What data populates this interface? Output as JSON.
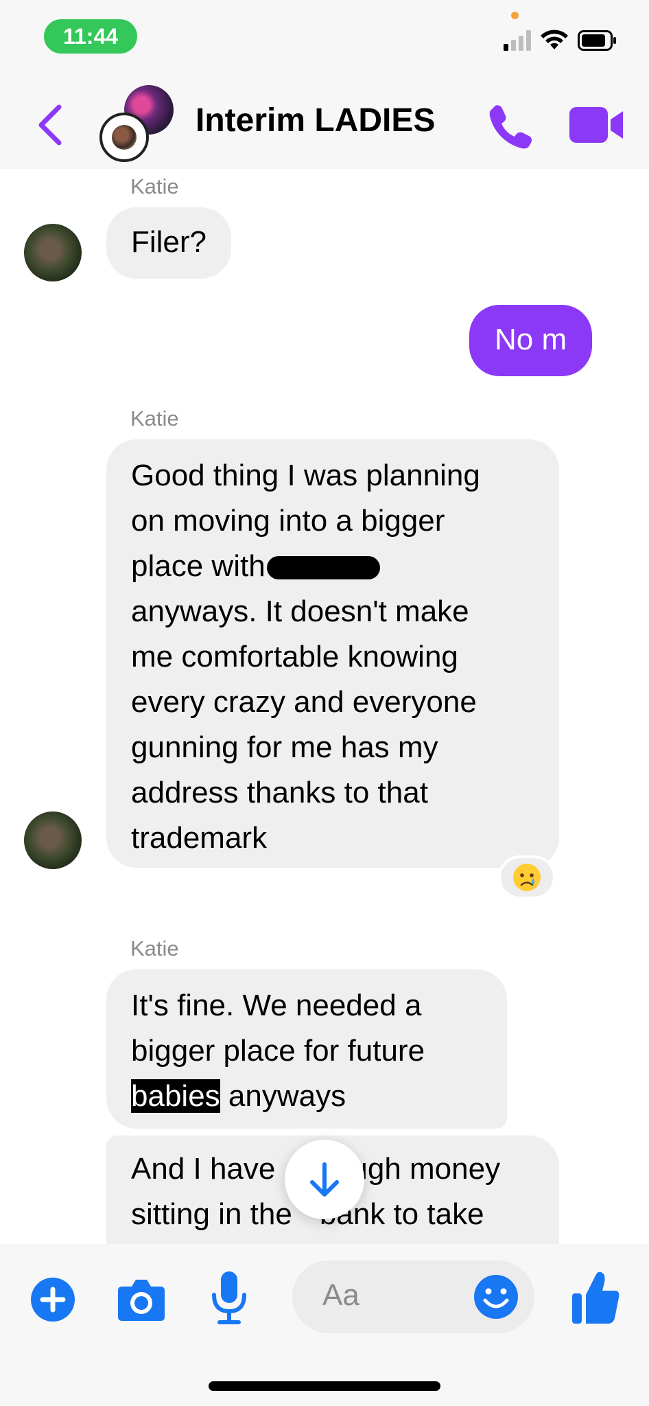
{
  "status_bar": {
    "time": "11:44"
  },
  "header": {
    "title": "Interim LADIES"
  },
  "messages": [
    {
      "sender": "Katie",
      "text": "Filer?"
    },
    {
      "sender": "me",
      "text": "No m"
    },
    {
      "sender": "Katie",
      "lines": [
        "Good thing I was planning",
        "on moving into a bigger",
        "place with",
        "anyways. It doesn't make",
        "me comfortable knowing",
        "every crazy and everyone",
        "gunning for me has my",
        "address thanks to that",
        "trademark"
      ],
      "reaction": "😢"
    },
    {
      "sender": "Katie",
      "line1": "It's fine. We needed a",
      "line2": "bigger place for future",
      "highlight": "babies",
      "line3_rest": " anyways"
    },
    {
      "sender": "Katie",
      "line1_a": "And I have",
      "line1_b": "ugh money",
      "line2_a": "sitting in the",
      "line2_b": "bank to take"
    }
  ],
  "composer": {
    "placeholder": "Aa"
  },
  "colors": {
    "accent": "#8b38f7",
    "composer_blue": "#1877f2",
    "time_pill": "#34c759"
  },
  "icons": [
    "back-icon",
    "phone-icon",
    "video-icon",
    "plus-icon",
    "camera-icon",
    "microphone-icon",
    "emoji-icon",
    "thumbs-up-icon",
    "arrow-down-icon"
  ]
}
